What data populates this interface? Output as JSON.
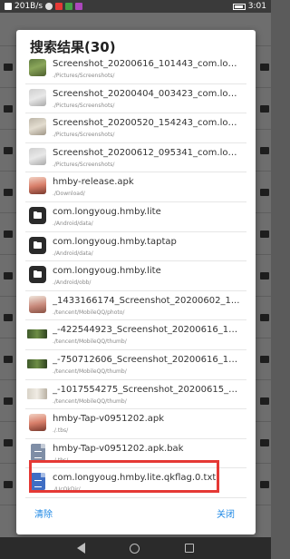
{
  "status_bar": {
    "speed": "201B/s",
    "time": "3:01"
  },
  "dialog": {
    "title": "搜索结果(30)",
    "items": [
      {
        "name": "Screenshot_20200616_101443_com.lon...",
        "path": "./Pictures/Screenshots/",
        "icon": "image-thumbnail-icon"
      },
      {
        "name": "Screenshot_20200404_003423_com.lon...",
        "path": "./Pictures/Screenshots/",
        "icon": "image-thumbnail-icon"
      },
      {
        "name": "Screenshot_20200520_154243_com.lon...",
        "path": "./Pictures/Screenshots/",
        "icon": "image-thumbnail-icon"
      },
      {
        "name": "Screenshot_20200612_095341_com.lon...",
        "path": "./Pictures/Screenshots/",
        "icon": "image-thumbnail-icon"
      },
      {
        "name": "hmby-release.apk",
        "path": "./Download/",
        "icon": "app-icon"
      },
      {
        "name": "com.longyoug.hmby.lite",
        "path": "./Android/data/",
        "icon": "folder-icon"
      },
      {
        "name": "com.longyoug.hmby.taptap",
        "path": "./Android/data/",
        "icon": "folder-icon"
      },
      {
        "name": "com.longyoug.hmby.lite",
        "path": "./Android/obb/",
        "icon": "folder-icon"
      },
      {
        "name": "_1433166174_Screenshot_20200602_1...",
        "path": "./tencent/MobileQQ/photo/",
        "icon": "image-thumbnail-icon"
      },
      {
        "name": "_-422544923_Screenshot_20200616_10...",
        "path": "./tencent/MobileQQ/thumb/",
        "icon": "image-thumbnail-icon"
      },
      {
        "name": "_-750712606_Screenshot_20200616_10...",
        "path": "./tencent/MobileQQ/thumb/",
        "icon": "image-thumbnail-icon"
      },
      {
        "name": "_-1017554275_Screenshot_20200615_1...",
        "path": "./tencent/MobileQQ/thumb/",
        "icon": "image-thumbnail-icon"
      },
      {
        "name": "hmby-Tap-v0951202.apk",
        "path": "./.tbs/",
        "icon": "app-icon",
        "highlighted": true
      },
      {
        "name": "hmby-Tap-v0951202.apk.bak",
        "path": "./.tbs/",
        "icon": "file-icon"
      },
      {
        "name": "com.longyoug.hmby.lite.qkflag.0.txt",
        "path": "./UcQkDir/",
        "icon": "document-icon"
      }
    ],
    "clear_label": "清除",
    "close_label": "关闭",
    "accent_color": "#1e88e5",
    "highlight_color": "#e53935"
  }
}
